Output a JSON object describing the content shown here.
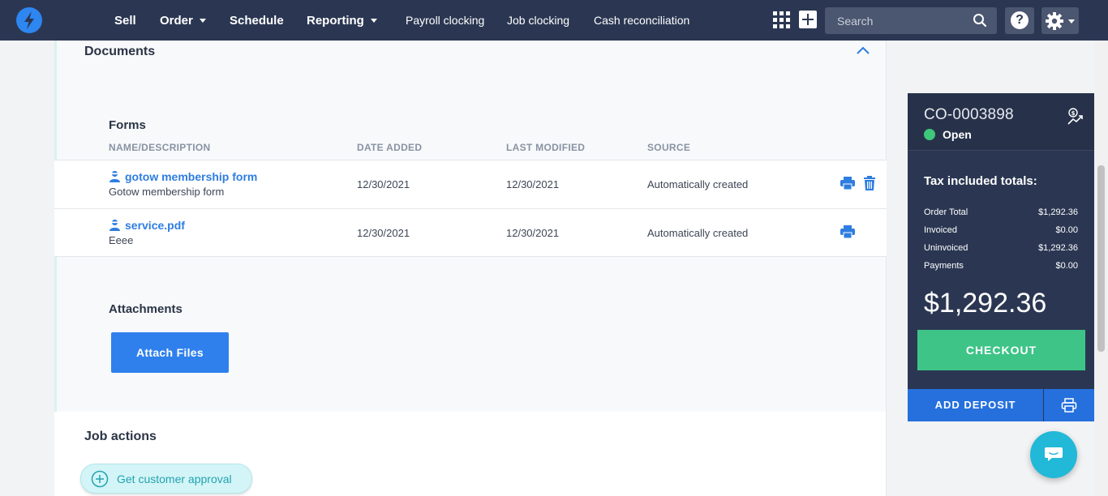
{
  "nav": {
    "items": [
      {
        "label": "Sell",
        "dropdown": false
      },
      {
        "label": "Order",
        "dropdown": true
      },
      {
        "label": "Schedule",
        "dropdown": false
      },
      {
        "label": "Reporting",
        "dropdown": true
      },
      {
        "label": "Payroll clocking",
        "dropdown": false
      },
      {
        "label": "Job clocking",
        "dropdown": false
      },
      {
        "label": "Cash reconciliation",
        "dropdown": false
      }
    ],
    "search_placeholder": "Search",
    "help_label": "?"
  },
  "documents": {
    "title": "Documents",
    "forms_label": "Forms",
    "columns": [
      "NAME/DESCRIPTION",
      "DATE ADDED",
      "LAST MODIFIED",
      "SOURCE"
    ],
    "rows": [
      {
        "name": "gotow membership form",
        "description": "Gotow membership form",
        "date_added": "12/30/2021",
        "last_modified": "12/30/2021",
        "source": "Automatically created",
        "actions": [
          "print-icon",
          "trash-icon"
        ]
      },
      {
        "name": "service.pdf",
        "description": "Eeee",
        "date_added": "12/30/2021",
        "last_modified": "12/30/2021",
        "source": "Automatically created",
        "actions": [
          "print-icon"
        ]
      }
    ],
    "attachments_label": "Attachments",
    "attach_button": "Attach Files"
  },
  "job_actions": {
    "title": "Job actions",
    "approval_button": "Get customer approval"
  },
  "order": {
    "id": "CO-0003898",
    "status": "Open",
    "status_color": "#3ec87a",
    "totals_title": "Tax included totals:",
    "totals": [
      {
        "label": "Order Total",
        "value": "$1,292.36"
      },
      {
        "label": "Invoiced",
        "value": "$0.00"
      },
      {
        "label": "Uninvoiced",
        "value": "$1,292.36"
      },
      {
        "label": "Payments",
        "value": "$0.00"
      }
    ],
    "big_total": "$1,292.36",
    "checkout_label": "CHECKOUT",
    "deposit_label": "ADD DEPOSIT"
  },
  "colors": {
    "nav_bg": "#2b3752",
    "accent_blue": "#2f80ed",
    "checkout_green": "#3ec487",
    "chat_cyan": "#22b8d8"
  }
}
